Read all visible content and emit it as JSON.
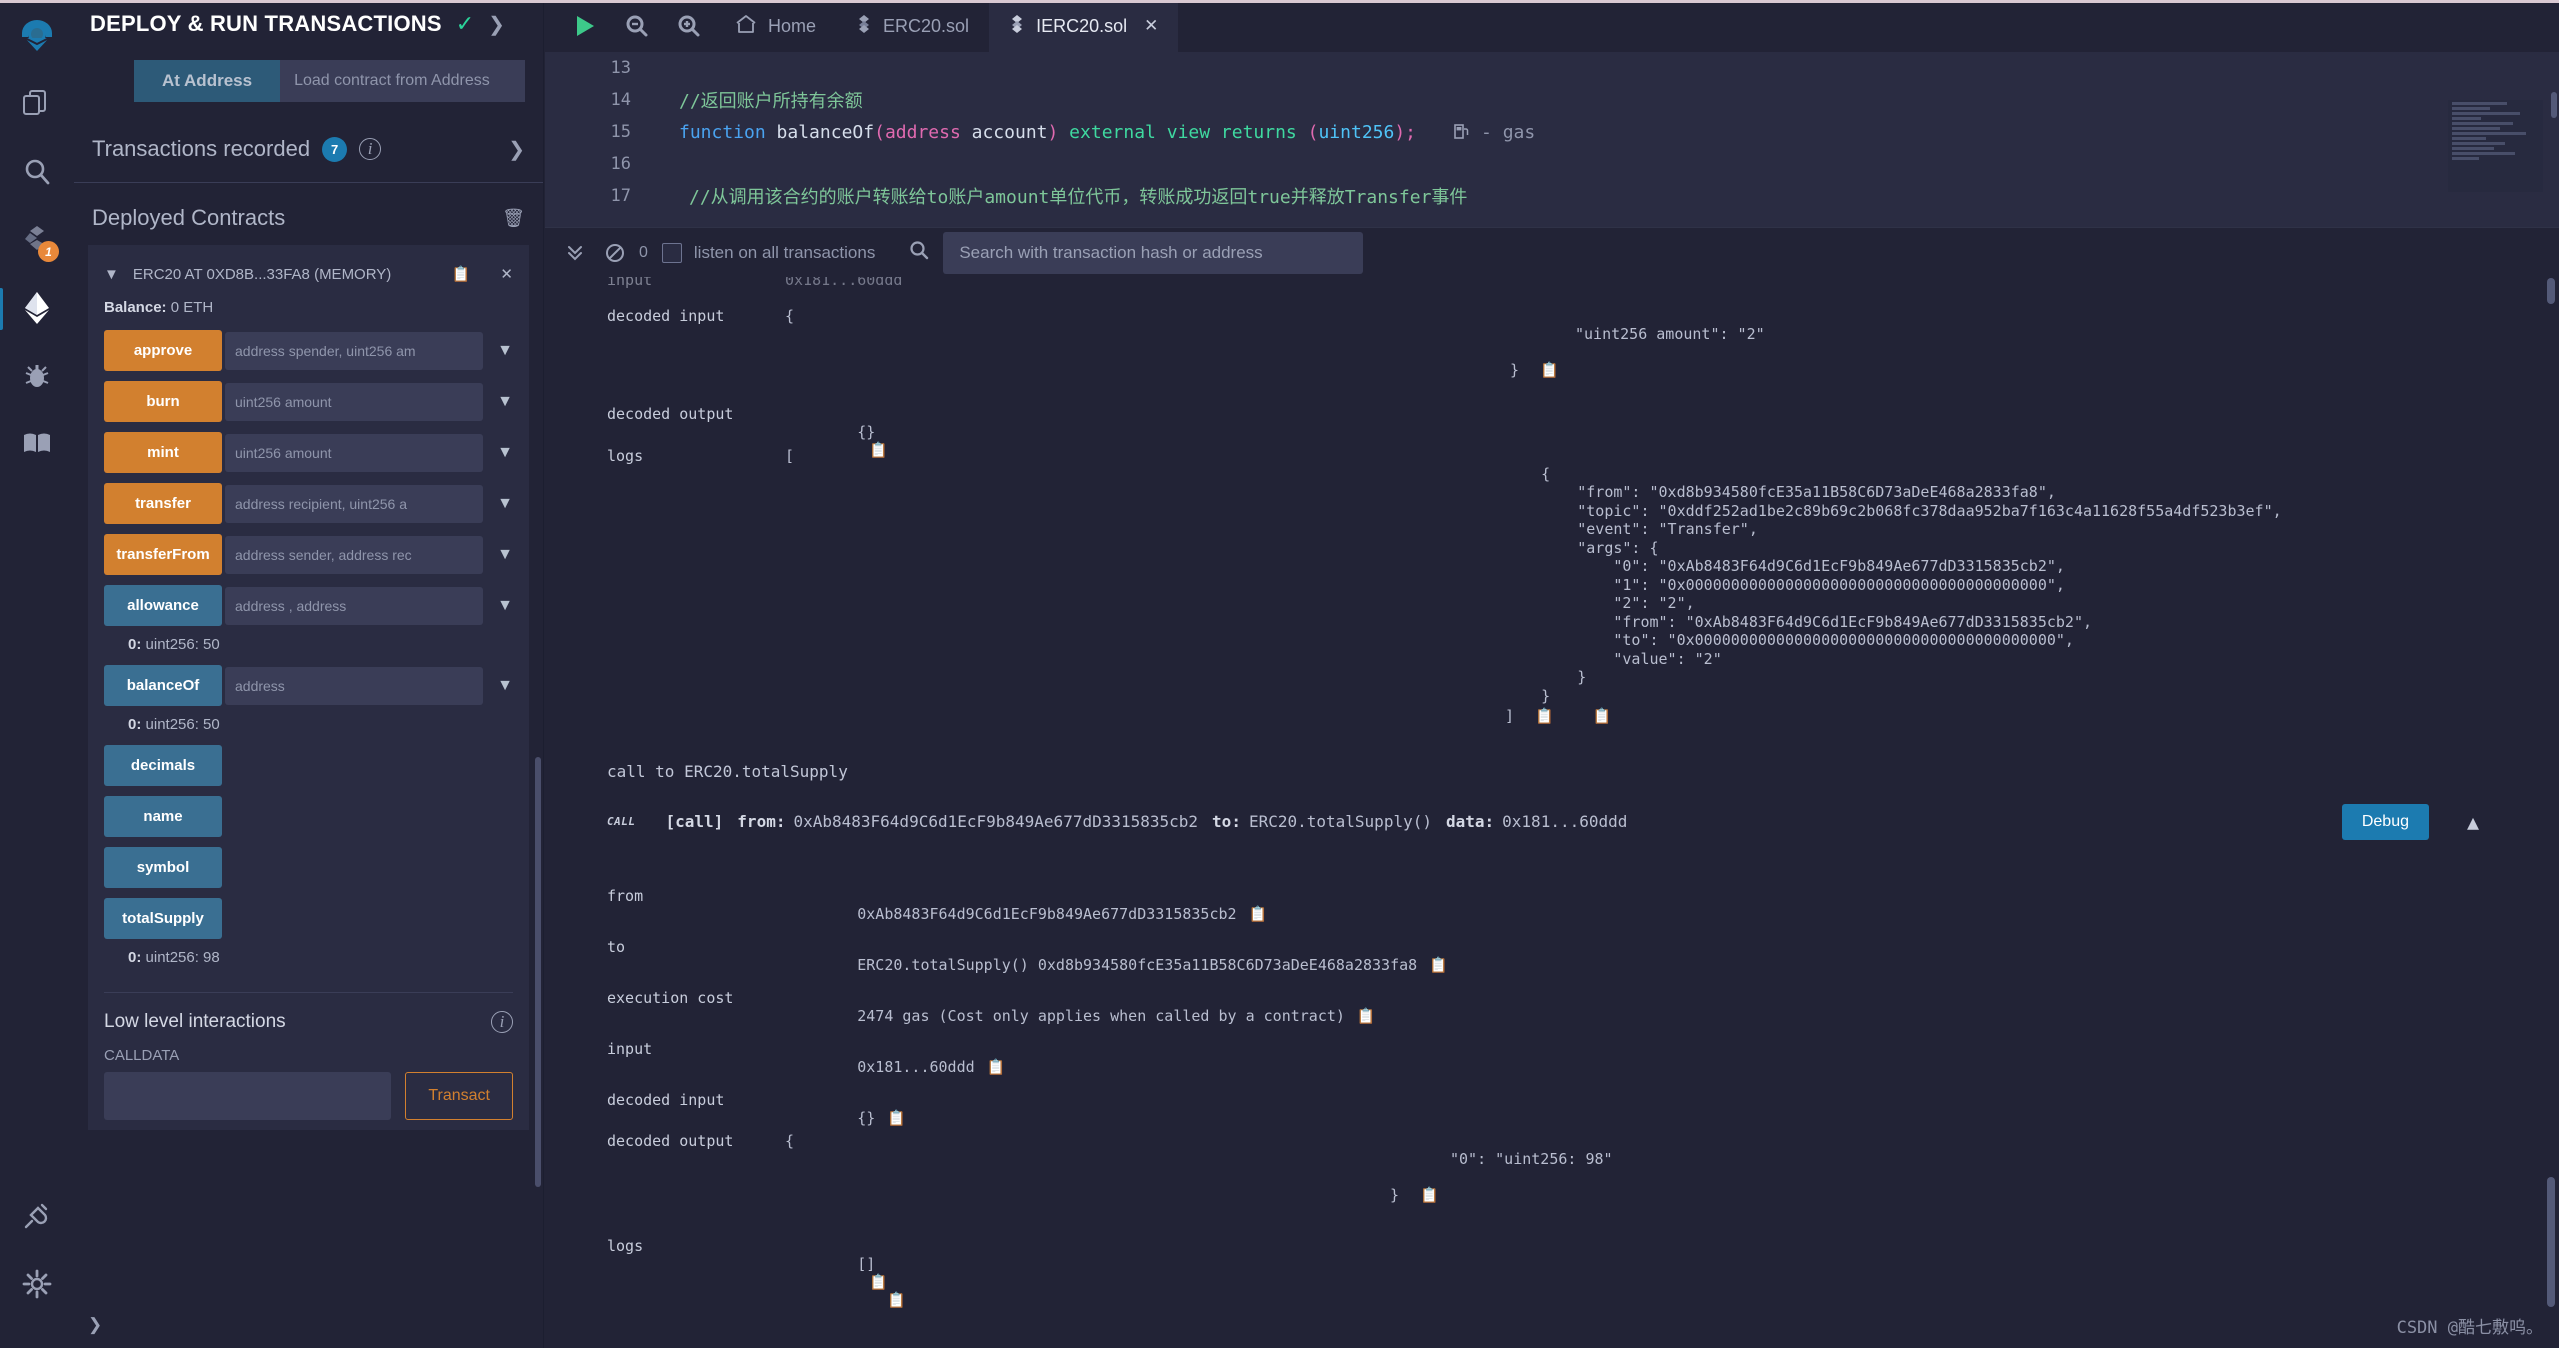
{
  "iconbar": {
    "items": [
      {
        "name": "remix-logo-icon",
        "label": "Remix"
      },
      {
        "name": "file-explorer-icon",
        "label": "File explorer"
      },
      {
        "name": "search-icon",
        "label": "Search in files"
      },
      {
        "name": "solidity-compiler-icon",
        "label": "Solidity compiler",
        "badge": "1"
      },
      {
        "name": "deploy-run-icon",
        "label": "Deploy & run transactions",
        "active": true
      },
      {
        "name": "debugger-icon",
        "label": "Debugger"
      },
      {
        "name": "plugin-manager-icon",
        "label": "Plugin manager"
      }
    ],
    "bottom": [
      {
        "name": "plugin-plug-icon",
        "label": "Plugins"
      },
      {
        "name": "settings-gear-icon",
        "label": "Settings"
      }
    ]
  },
  "panel": {
    "title": "DEPLOY & RUN TRANSACTIONS",
    "at_address_button": "At Address",
    "at_address_placeholder": "Load contract from Address",
    "at_address_value": "",
    "transactions_recorded_label": "Transactions recorded",
    "transactions_recorded_count": "7",
    "deployed_contracts_label": "Deployed Contracts",
    "contract": {
      "name": "ERC20 AT 0XD8B...33FA8 (MEMORY)",
      "balance_label": "Balance:",
      "balance_value": "0 ETH"
    },
    "functions": [
      {
        "label": "approve",
        "kind": "write",
        "placeholder": "address spender, uint256 am",
        "value": "",
        "result": null
      },
      {
        "label": "burn",
        "kind": "write",
        "placeholder": "uint256 amount",
        "value": "",
        "result": null
      },
      {
        "label": "mint",
        "kind": "write",
        "placeholder": "uint256 amount",
        "value": "",
        "result": null
      },
      {
        "label": "transfer",
        "kind": "write",
        "placeholder": "address recipient, uint256 a",
        "value": "",
        "result": null
      },
      {
        "label": "transferFrom",
        "kind": "write",
        "placeholder": "address sender, address rec",
        "value": "",
        "result": null
      },
      {
        "label": "allowance",
        "kind": "read",
        "placeholder": "address , address",
        "value": "",
        "result_index": "0:",
        "result": "uint256: 50"
      },
      {
        "label": "balanceOf",
        "kind": "read",
        "placeholder": "address",
        "value": "",
        "result_index": "0:",
        "result": "uint256: 50"
      },
      {
        "label": "decimals",
        "kind": "read",
        "placeholder": null,
        "result": null
      },
      {
        "label": "name",
        "kind": "read",
        "placeholder": null,
        "result": null
      },
      {
        "label": "symbol",
        "kind": "read",
        "placeholder": null,
        "result": null
      },
      {
        "label": "totalSupply",
        "kind": "read",
        "placeholder": null,
        "result_index": "0:",
        "result": "uint256: 98"
      }
    ],
    "low_level": {
      "title": "Low level interactions",
      "calldata_label": "CALLDATA",
      "calldata_value": "",
      "transact_button": "Transact"
    }
  },
  "tabs": {
    "run_icon": "play-icon",
    "zoom_out_icon": "zoom-out-icon",
    "zoom_in_icon": "zoom-in-icon",
    "items": [
      {
        "label": "Home",
        "icon": "home-icon",
        "active": false,
        "closable": false
      },
      {
        "label": "ERC20.sol",
        "icon": "solidity-icon",
        "active": false,
        "closable": false
      },
      {
        "label": "IERC20.sol",
        "icon": "solidity-icon",
        "active": true,
        "closable": true
      }
    ]
  },
  "editor": {
    "lines": [
      {
        "num": "13",
        "tokens": []
      },
      {
        "num": "14",
        "tokens": [
          {
            "t": "//返回账户所持有余额",
            "c": "c-cmt"
          }
        ]
      },
      {
        "num": "15",
        "tokens": [
          {
            "t": "function ",
            "c": "c-kw"
          },
          {
            "t": "balanceOf",
            "c": "c-fn"
          },
          {
            "t": "(",
            "c": "c-pn"
          },
          {
            "t": "address",
            "c": "c-ty"
          },
          {
            "t": " account",
            "c": "c-fn"
          },
          {
            "t": ")",
            "c": "c-pn"
          },
          {
            "t": " external",
            "c": "c-grn"
          },
          {
            "t": " view",
            "c": "c-grn"
          },
          {
            "t": " returns",
            "c": "c-grn"
          },
          {
            "t": " (",
            "c": "c-pn"
          },
          {
            "t": "uint256",
            "c": "c-num"
          },
          {
            "t": ")",
            "c": "c-pn"
          },
          {
            "t": ";",
            "c": "c-ty"
          }
        ],
        "gas": "- gas",
        "gas_icon": "gas-pump-icon"
      },
      {
        "num": "16",
        "tokens": []
      },
      {
        "num": "17",
        "tokens": [
          {
            "t": "//从调用该合约的账户转账给to账户amount单位代币，转账成功返回true并释放Transfer事件",
            "c": "c-cmt"
          }
        ]
      }
    ]
  },
  "terminal_toolbar": {
    "collapse_icon": "double-chevron-down-icon",
    "clear_icon": "no-entry-icon",
    "pending_count": "0",
    "listen_label": "listen on all transactions",
    "listen_checked": false,
    "search_icon": "search-icon",
    "search_placeholder": "Search with transaction hash or address",
    "search_value": ""
  },
  "terminal": {
    "tx1": {
      "rows": [
        {
          "key": "decoded input",
          "lines": [
            "{",
            "        \"uint256 amount\": \"2\"",
            "",
            "}"
          ],
          "copy": true
        },
        {
          "key": "decoded output",
          "lines": [
            "{}"
          ],
          "copy": true
        },
        {
          "key": "logs",
          "lines": [
            "[",
            "    {",
            "        \"from\": \"0xd8b934580fcE35a11B58C6D73aDeE468a2833fa8\",",
            "        \"topic\": \"0xddf252ad1be2c89b69c2b068fc378daa952ba7f163c4a11628f55a4df523b3ef\",",
            "        \"event\": \"Transfer\",",
            "        \"args\": {",
            "            \"0\": \"0xAb8483F64d9C6d1EcF9b849Ae677dD3315835cb2\",",
            "            \"1\": \"0x0000000000000000000000000000000000000000\",",
            "            \"2\": \"2\",",
            "            \"from\": \"0xAb8483F64d9C6d1EcF9b849Ae677dD3315835cb2\",",
            "            \"to\": \"0x0000000000000000000000000000000000000000\",",
            "            \"value\": \"2\"",
            "        }",
            "    }",
            "]"
          ],
          "copy": true,
          "copy2": true
        }
      ]
    },
    "tx2": {
      "title": "call to ERC20.totalSupply",
      "header": {
        "tag": "CALL",
        "bracket": "[call]",
        "from_label": "from:",
        "from_value": "0xAb8483F64d9C6d1EcF9b849Ae677dD3315835cb2",
        "to_label": "to:",
        "to_value": "ERC20.totalSupply()",
        "data_label": "data:",
        "data_value": "0x181...60ddd"
      },
      "debug_button": "Debug",
      "collapse_icon": "chevron-up-icon",
      "rows": [
        {
          "key": "from",
          "value": "0xAb8483F64d9C6d1EcF9b849Ae677dD3315835cb2",
          "copy": true
        },
        {
          "key": "to",
          "value": "ERC20.totalSupply() 0xd8b934580fcE35a11B58C6D73aDeE468a2833fa8",
          "copy": true
        },
        {
          "key": "execution cost",
          "value": "2474 gas (Cost only applies when called by a contract)",
          "copy": true
        },
        {
          "key": "input",
          "value": "0x181...60ddd",
          "copy": true
        },
        {
          "key": "decoded input",
          "value": "{}",
          "copy": true
        },
        {
          "key": "decoded output",
          "multiline": [
            "{",
            "        \"0\": \"uint256: 98\"",
            "",
            "}"
          ],
          "copy": true
        },
        {
          "key": "logs",
          "value": "[]",
          "copy": true,
          "copy2": true
        }
      ]
    }
  },
  "watermark": "CSDN @酷七敷呜。",
  "colors": {
    "write_button": "#d2802f",
    "read_button": "#3a6f92",
    "accent": "#1c7bb0",
    "panel_bg": "#2a2c42",
    "app_bg": "#222336"
  }
}
